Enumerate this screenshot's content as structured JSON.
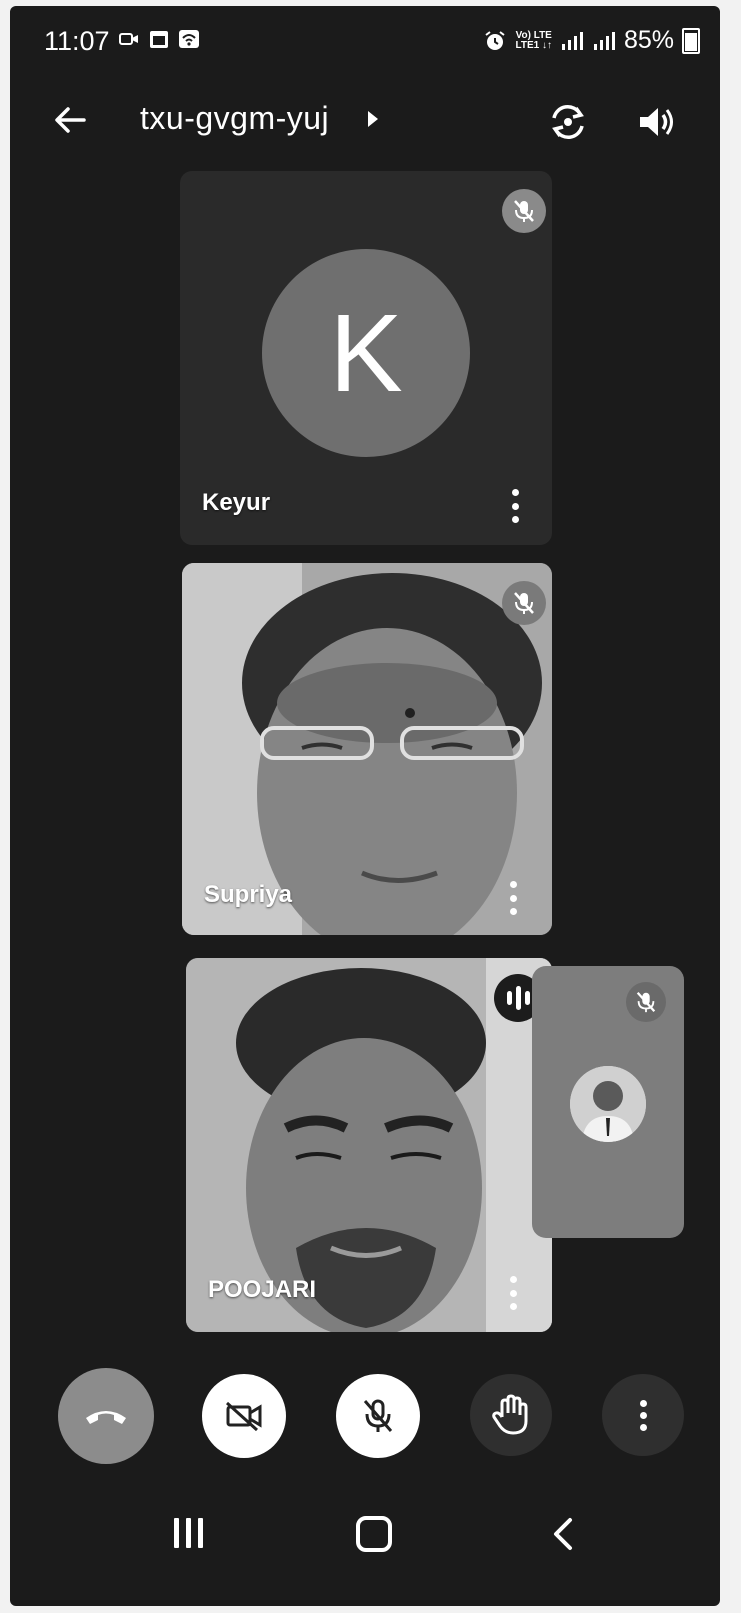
{
  "status_bar": {
    "time": "11:07",
    "lte_top": "Vo) LTE",
    "lte_bottom": "LTE1 ↓↑",
    "battery": "85%"
  },
  "header": {
    "meeting_code": "txu-gvgm-yuj"
  },
  "participants": [
    {
      "name": "Keyur",
      "initial": "K",
      "muted": true,
      "video": false
    },
    {
      "name": "Supriya",
      "muted": true,
      "video": true
    },
    {
      "name": "POOJARI",
      "muted": false,
      "speaking": true,
      "video": true
    }
  ],
  "self_view": {
    "muted": true
  },
  "controls": [
    "end-call",
    "camera-off",
    "mic-off",
    "raise-hand",
    "more-options"
  ],
  "colors": {
    "background": "#1b1b1b",
    "button_light": "#ffffff",
    "button_gray": "#8c8c8c"
  }
}
